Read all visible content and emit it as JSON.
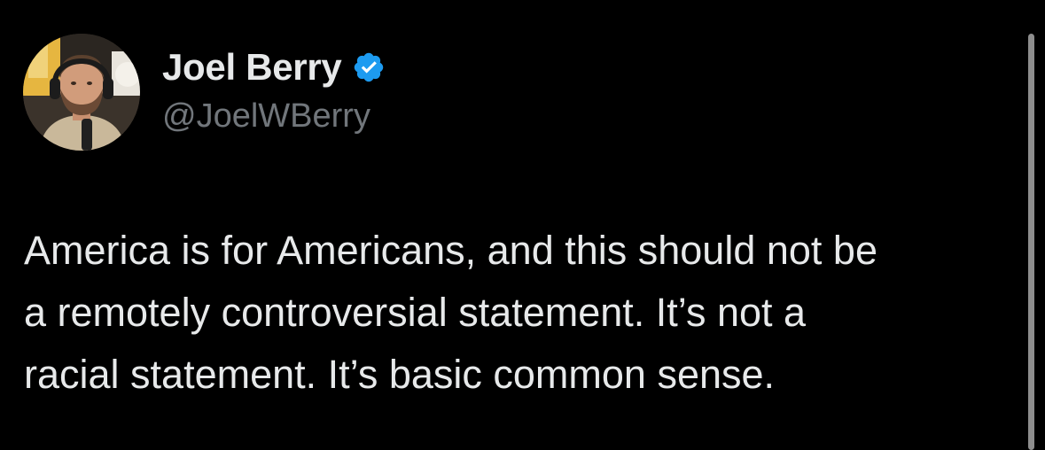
{
  "author": {
    "display_name": "Joel Berry",
    "handle": "@JoelWBerry",
    "verified": true,
    "verified_color": "#1d9bf0",
    "avatar_icon": "profile-photo"
  },
  "tweet": {
    "lines": [
      "America is for Americans, and this should not be",
      "a remotely controversial statement. It’s not a",
      "racial statement. It’s basic common sense."
    ]
  },
  "colors": {
    "background": "#000000",
    "text": "#e7e9ea",
    "secondary_text": "#71767b"
  }
}
